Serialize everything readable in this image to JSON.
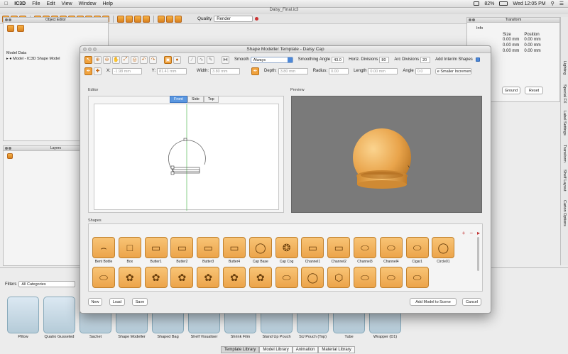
{
  "menubar": {
    "app": "IC3D",
    "items": [
      "File",
      "Edit",
      "View",
      "Window",
      "Help"
    ],
    "battery": "82%",
    "clock": "Wed 12:05 PM"
  },
  "main_window": {
    "title": "Daisy_Final.ic3",
    "quality_label": "Quality",
    "quality_value": "Render"
  },
  "object_editor": {
    "title": "Object Editor",
    "model_data_label": "Model Data",
    "model_item": "Model - IC3D Shape Model"
  },
  "layers": {
    "title": "Layers"
  },
  "transform": {
    "title": "Transform",
    "info_label": "Info",
    "col_size": "Size",
    "col_position": "Position",
    "rows": [
      {
        "size": "0.00 mm",
        "position": "0.00 mm"
      },
      {
        "size": "0.00 mm",
        "position": "0.00 mm"
      },
      {
        "size": "0.00 mm",
        "position": "0.00 mm"
      }
    ],
    "ground_btn": "Ground",
    "reset_btn": "Reset"
  },
  "side_tabs": [
    "Lighting",
    "Special FX",
    "Label Settings",
    "Transform",
    "Shelf Layout",
    "Carton Options"
  ],
  "modeller": {
    "title": "Shape Modeller Template - Daisy Cap",
    "smooth_label": "Smooth",
    "smooth_value": "Always",
    "smoothing_angle_label": "Smoothing Angle",
    "smoothing_angle_value": "43.0",
    "horiz_div_label": "Horiz. Divisions",
    "horiz_div_value": "80",
    "arc_div_label": "Arc Divisions",
    "arc_div_value": "20",
    "add_interim_label": "Add Interim Shapes",
    "x_label": "X:",
    "x_value": "-1.98 mm",
    "y_label": "Y:",
    "y_value": "81.41 mm",
    "width_label": "Width:",
    "width_value": "3.80 mm",
    "depth_label": "Depth:",
    "depth_value": "3.80 mm",
    "radius_label": "Radius:",
    "radius_value": "0.00",
    "length_label": "Length",
    "length_value": "0.00 mm",
    "angle_label": "Angle",
    "angle_value": "0.0",
    "smaller_incr_btn": "e Smaller Incremen",
    "editor_label": "Editor",
    "preview_label": "Preview",
    "view_tabs": [
      "Front",
      "Side",
      "Top"
    ],
    "shapes_label": "Shapes",
    "shapes_row1": [
      "Bent Bottle",
      "Box",
      "Butter1",
      "Butter2",
      "Butter3",
      "Butter4",
      "Cap Base",
      "Cap Cog",
      "Channel1",
      "Channel2",
      "Channel3",
      "Channel4",
      "Cigar1",
      "Circle01"
    ],
    "btn_new": "New",
    "btn_load": "Load",
    "btn_save": "Save",
    "btn_add_model": "Add Model to Scene",
    "btn_cancel": "Cancel",
    "accent": "#f0a23d",
    "selection_blue": "#5a97e0"
  },
  "library": {
    "filters_label": "Filters",
    "filter_value": "All Categories",
    "thumbs": [
      "Pillow",
      "Quatro Gusseted",
      "Sachet",
      "Shape Modeller",
      "Shaped Bag",
      "Shelf Visualiser",
      "Shrink Film",
      "Stand Up Pouch",
      "SU Pouch (Top)",
      "Tube",
      "Wrapper (D1)"
    ],
    "tabs": [
      "Template Library",
      "Model Library",
      "Animation",
      "Material Library"
    ]
  }
}
